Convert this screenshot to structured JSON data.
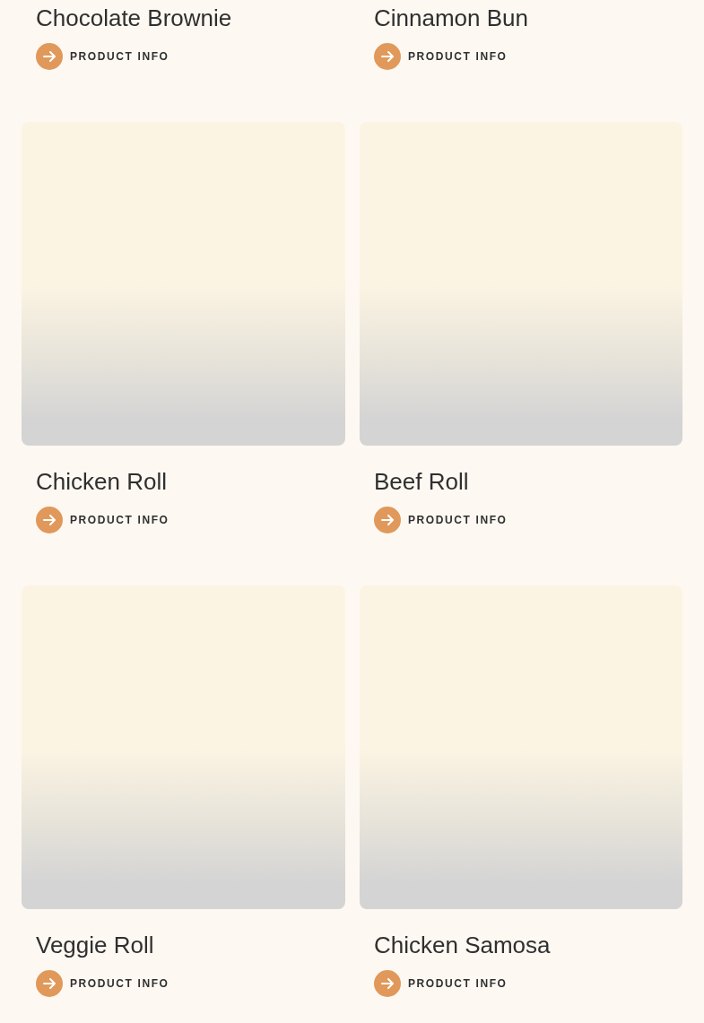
{
  "products": [
    {
      "name": "Chocolate Brownie",
      "link": "PRODUCT INFO",
      "has_image": false
    },
    {
      "name": "Cinnamon Bun",
      "link": "PRODUCT INFO",
      "has_image": false
    },
    {
      "name": "Chicken Roll",
      "link": "PRODUCT INFO",
      "has_image": true
    },
    {
      "name": "Beef Roll",
      "link": "PRODUCT INFO",
      "has_image": true
    },
    {
      "name": "Veggie Roll",
      "link": "PRODUCT INFO",
      "has_image": true
    },
    {
      "name": "Chicken Samosa",
      "link": "PRODUCT INFO",
      "has_image": true
    }
  ]
}
